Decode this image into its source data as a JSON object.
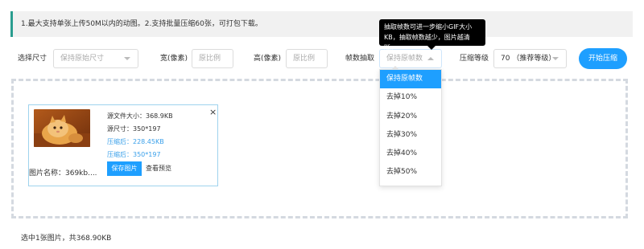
{
  "notice": {
    "text": "1.最大支持单张上传50M以内的动图。2.支持批量压缩60张，可打包下载。"
  },
  "tooltip": {
    "line1": "抽取帧数可进一步缩小GIF大小",
    "line2": "KB，抽取帧数越少，图片越清晰。"
  },
  "toolbar": {
    "size_label": "选择尺寸",
    "size_value": "保持原始尺寸",
    "width_label": "宽(像素)",
    "width_placeholder": "原比例",
    "height_label": "高(像素)",
    "height_placeholder": "原比例",
    "frames_label": "帧数抽取",
    "frames_value": "保持原帧数",
    "level_label": "压缩等级",
    "level_value": "70 （推荐等级）",
    "start_label": "开始压缩"
  },
  "frames_options": [
    "保持原帧数",
    "去掉10%",
    "去掉20%",
    "去掉30%",
    "去掉40%",
    "去掉50%"
  ],
  "card": {
    "orig_size": "源文件大小：368.9KB",
    "orig_dims": "源尺寸：350*197",
    "comp_size": "压缩后：228.45KB",
    "comp_dims": "压缩后：350*197",
    "close": "×",
    "filename": "图片名称：369kb....",
    "save_label": "保存图片",
    "preview_label": "查看预览"
  },
  "footer": {
    "text": "选中1张图片，共368.90KB"
  },
  "colors": {
    "accent": "#1e9fff",
    "notice_bar": "#2a9d8f",
    "blue_text": "#3aa0ea"
  }
}
